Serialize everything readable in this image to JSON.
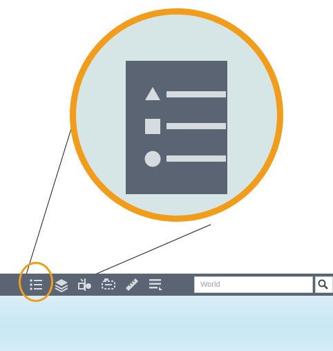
{
  "colors": {
    "accent": "#f29c1c",
    "toolbar": "#5b6472",
    "icon_light": "#d6dbe0",
    "magnifier_bg": "#d6e5e5",
    "map_water": "#cfe9f6"
  },
  "magnified": {
    "icon": "legend-icon"
  },
  "toolbar": {
    "buttons": [
      {
        "icon": "legend-icon"
      },
      {
        "icon": "layers-icon"
      },
      {
        "icon": "basemap-icon"
      },
      {
        "icon": "bookmarks-icon"
      },
      {
        "icon": "measure-icon"
      },
      {
        "icon": "table-of-contents-icon"
      }
    ]
  },
  "search": {
    "placeholder": "World",
    "button_icon": "search-icon"
  }
}
